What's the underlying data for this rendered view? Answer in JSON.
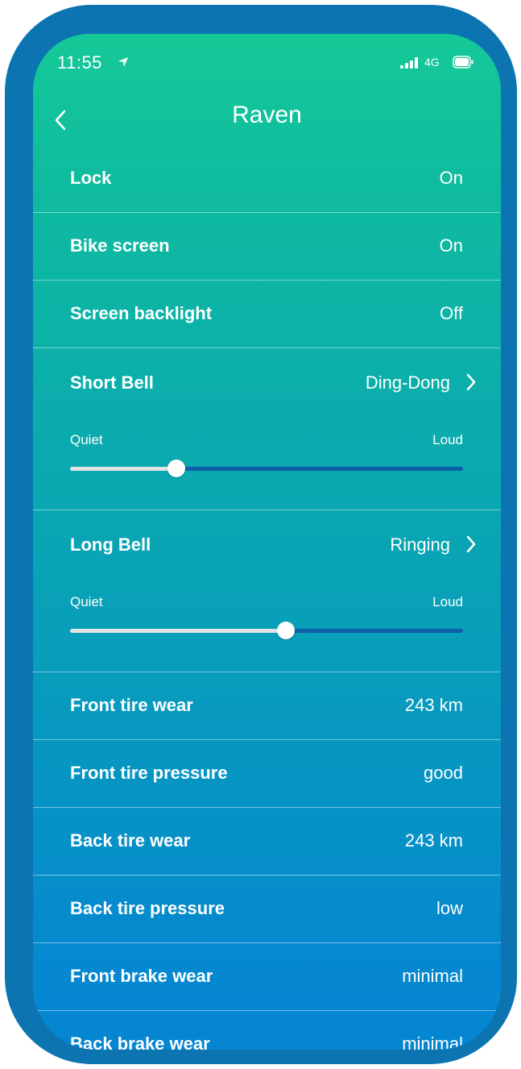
{
  "status_bar": {
    "time": "11:55",
    "network": "4G"
  },
  "header": {
    "title": "Raven"
  },
  "settings": [
    {
      "label": "Lock",
      "value": "On"
    },
    {
      "label": "Bike screen",
      "value": "On"
    },
    {
      "label": "Screen backlight",
      "value": "Off"
    }
  ],
  "short_bell": {
    "label": "Short Bell",
    "value": "Ding-Dong",
    "min_label": "Quiet",
    "max_label": "Loud",
    "level": 0.27
  },
  "long_bell": {
    "label": "Long Bell",
    "value": "Ringing",
    "min_label": "Quiet",
    "max_label": "Loud",
    "level": 0.55
  },
  "stats": [
    {
      "label": "Front tire wear",
      "value": "243 km"
    },
    {
      "label": "Front tire pressure",
      "value": "good"
    },
    {
      "label": "Back tire wear",
      "value": "243 km"
    },
    {
      "label": "Back tire pressure",
      "value": "low"
    },
    {
      "label": "Front brake wear",
      "value": "minimal"
    },
    {
      "label": "Back brake wear",
      "value": "minimal"
    }
  ],
  "colors": {
    "frame": "#0c74b1",
    "gradient_top": "#15c997",
    "gradient_bottom": "#0586d3",
    "slider_track": "#0f5ea8"
  }
}
